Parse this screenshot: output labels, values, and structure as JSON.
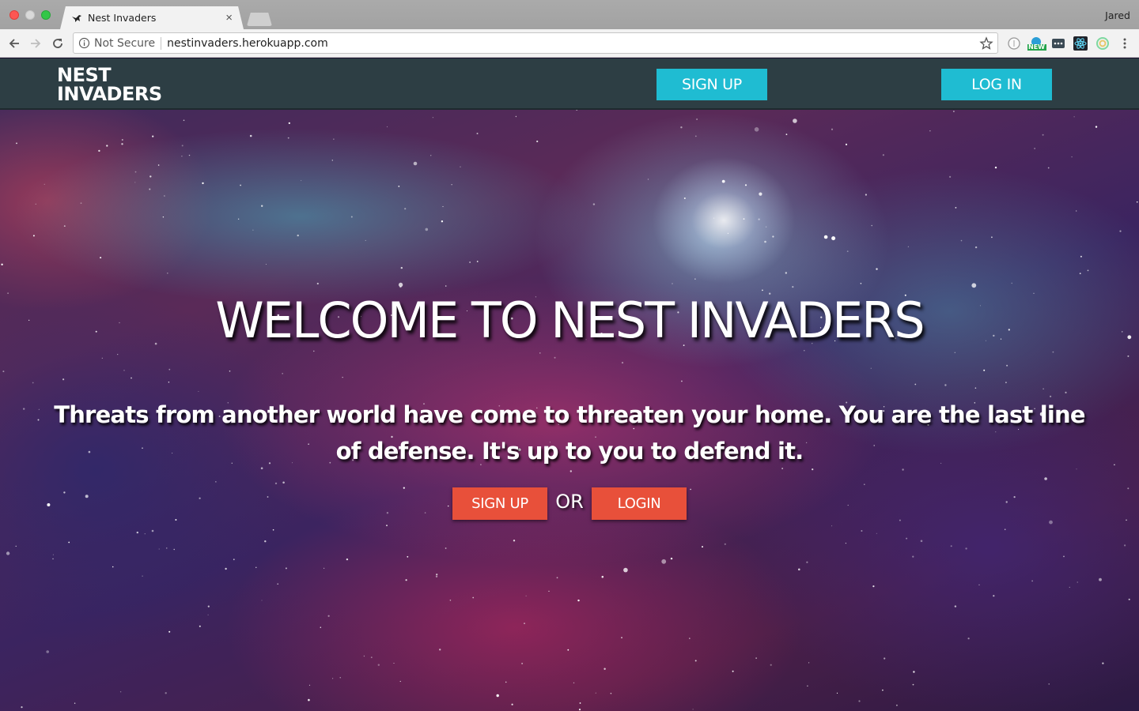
{
  "browser": {
    "tab_title": "Nest Invaders",
    "tab_close": "×",
    "profile_name": "Jared",
    "security_label": "Not Secure",
    "url": "nestinvaders.herokuapp.com",
    "extension_badge": "NEW"
  },
  "site": {
    "brand_line1": "NEST",
    "brand_line2": "INVADERS",
    "nav_signup": "SIGN UP",
    "nav_login": "LOG IN"
  },
  "hero": {
    "title": "WELCOME TO NEST INVADERS",
    "subtitle": "Threats from another world have come to threaten your home. You are the last line of defense. It's up to you to defend it.",
    "cta_signup": "SIGN UP",
    "cta_or": "OR",
    "cta_login": "LOGIN"
  },
  "colors": {
    "nav_background": "#2d3e44",
    "nav_button": "#1fbcd2",
    "cta_button": "#e8503a"
  }
}
